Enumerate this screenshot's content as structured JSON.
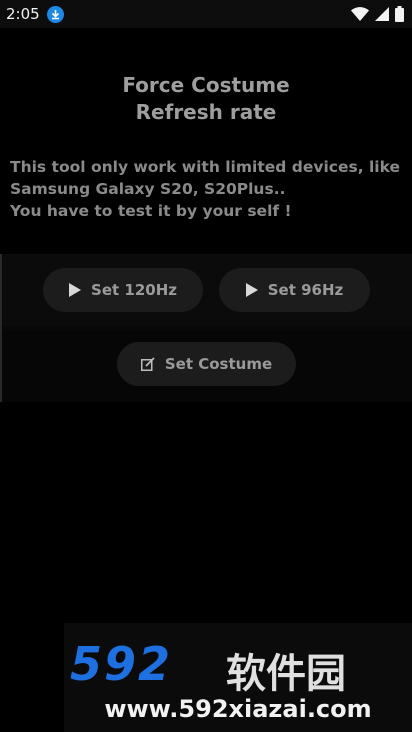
{
  "status_bar": {
    "time": "2:05",
    "icons": [
      "download-icon",
      "wifi-icon",
      "signal-icon",
      "battery-icon"
    ]
  },
  "app": {
    "title_line1": "Force Costume",
    "title_line2": "Refresh rate",
    "description_line1": "This tool only work with limited devices, like",
    "description_line2": "Samsung Galaxy S20, S20Plus..",
    "description_line3": "You have to test it by your self !"
  },
  "buttons": {
    "set_120": "Set 120Hz",
    "set_96": "Set 96Hz",
    "set_costume": "Set Costume"
  },
  "watermark": {
    "logo": "592",
    "logo_cn": "软件园",
    "url": "www.592xiazai.com"
  },
  "colors": {
    "background": "#000000",
    "button": "#1c1c1c",
    "text": "#9a9a9a",
    "watermark_blue": "#1e6fe0"
  }
}
